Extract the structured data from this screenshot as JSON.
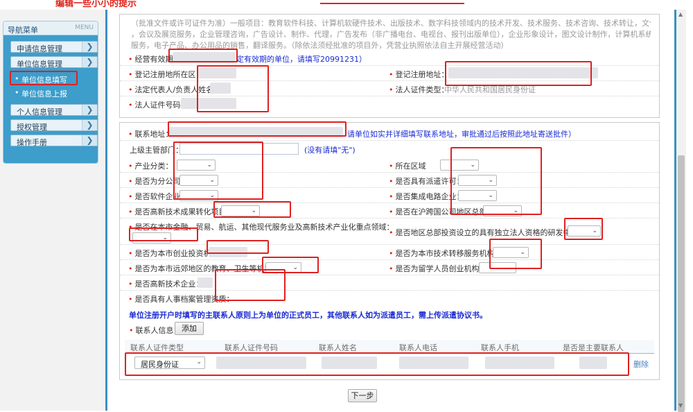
{
  "header": {
    "left_text": "编辑一些小小的提示",
    "right_text": ""
  },
  "nav": {
    "title": "导航菜单",
    "title_en": "MENU",
    "items": [
      {
        "label": "申请信息管理"
      },
      {
        "label": "单位信息管理"
      },
      {
        "label": "个人信息管理"
      },
      {
        "label": "授权管理"
      },
      {
        "label": "操作手册"
      }
    ],
    "subitems": [
      {
        "label": "单位信息填写"
      },
      {
        "label": "单位信息上报"
      }
    ]
  },
  "business_scope": {
    "text_line1": "（批准文件或许可证件为准）一般项目：教育软件科技、计算机软硬件技术、出版技术、数字科技领域内的技术开发、技术服务、技术咨询、技术转让，文化艺术交流活动策划",
    "text_line2": "，会议及展览服务，企业管理咨询，广告设计、制作、代理，广告发布（非广播电台、电视台、报刊出版单位），企业形象设计，图文设计制作，计算机系统集成，专业设计",
    "text_line3": "服务，电子产品、办公用品的销售，翻译服务。（除依法须经批准的项目外，凭营业执照依法自主开展经营活动）"
  },
  "basic": {
    "validity_label": "经营有效期：",
    "validity_hint": "定有效期的单位，请填写20991231）",
    "reg_area_label": "登记注册地所在区：",
    "reg_address_label": "登记注册地址：",
    "legal_rep_label": "法定代表人/负责人姓名：",
    "legal_id_type_label": "法人证件类型：",
    "legal_id_type_value": "中华人民共和国居民身份证",
    "legal_id_no_label": "法人证件号码："
  },
  "contact_section": {
    "address_label": "联系地址：",
    "address_hint": "请单位如实并详细填写联系地址，审批通过后按照此地址寄送批件）",
    "superior_label": "上级主管部门：",
    "superior_hint": "(没有请填\"无\")",
    "industry_label": "产业分类：",
    "region_label": "所在区域",
    "branch_label": "是否为分公司：",
    "dispatch_label": "是否具有派遣许可：",
    "software_label": "是否软件企业：",
    "ic_label": "是否集成电路企业：",
    "hightech_transform_label": "是否高新技术成果转化项目：",
    "hq_label": "是否在沪跨国公司地区总部：",
    "finance_label": "是否在本市金融、贸易、航运、其他现代服务业及高新技术产业化重点领域：",
    "rd_center_label": "是否地区总部投资设立的具有独立法人资格的研发中心：",
    "venture_label": "是否为本市创业投资机构：",
    "tech_transfer_label": "是否为本市技术转移服务机构：",
    "remote_label": "是否为本市远郊地区的教育、卫生等机构：",
    "returnee_label": "是否为留学人员创业机构：",
    "hightech_label": "是否高新技术企业：",
    "archive_label": "是否具有人事档案管理资质："
  },
  "notice": "单位注册开户时填写的主联系人原则上为单位的正式员工，其他联系人如为派遣员工，需上传派遣协议书。",
  "contacts": {
    "label": "联系人信息：",
    "add_button": "添加",
    "columns": [
      "联系人证件类型",
      "联系人证件号码",
      "联系人姓名",
      "联系人电话",
      "联系人手机",
      "是否是主要联系人"
    ],
    "rows": [
      {
        "id_type": "居民身份证",
        "delete": "删除"
      }
    ]
  },
  "next_button": "下一步"
}
